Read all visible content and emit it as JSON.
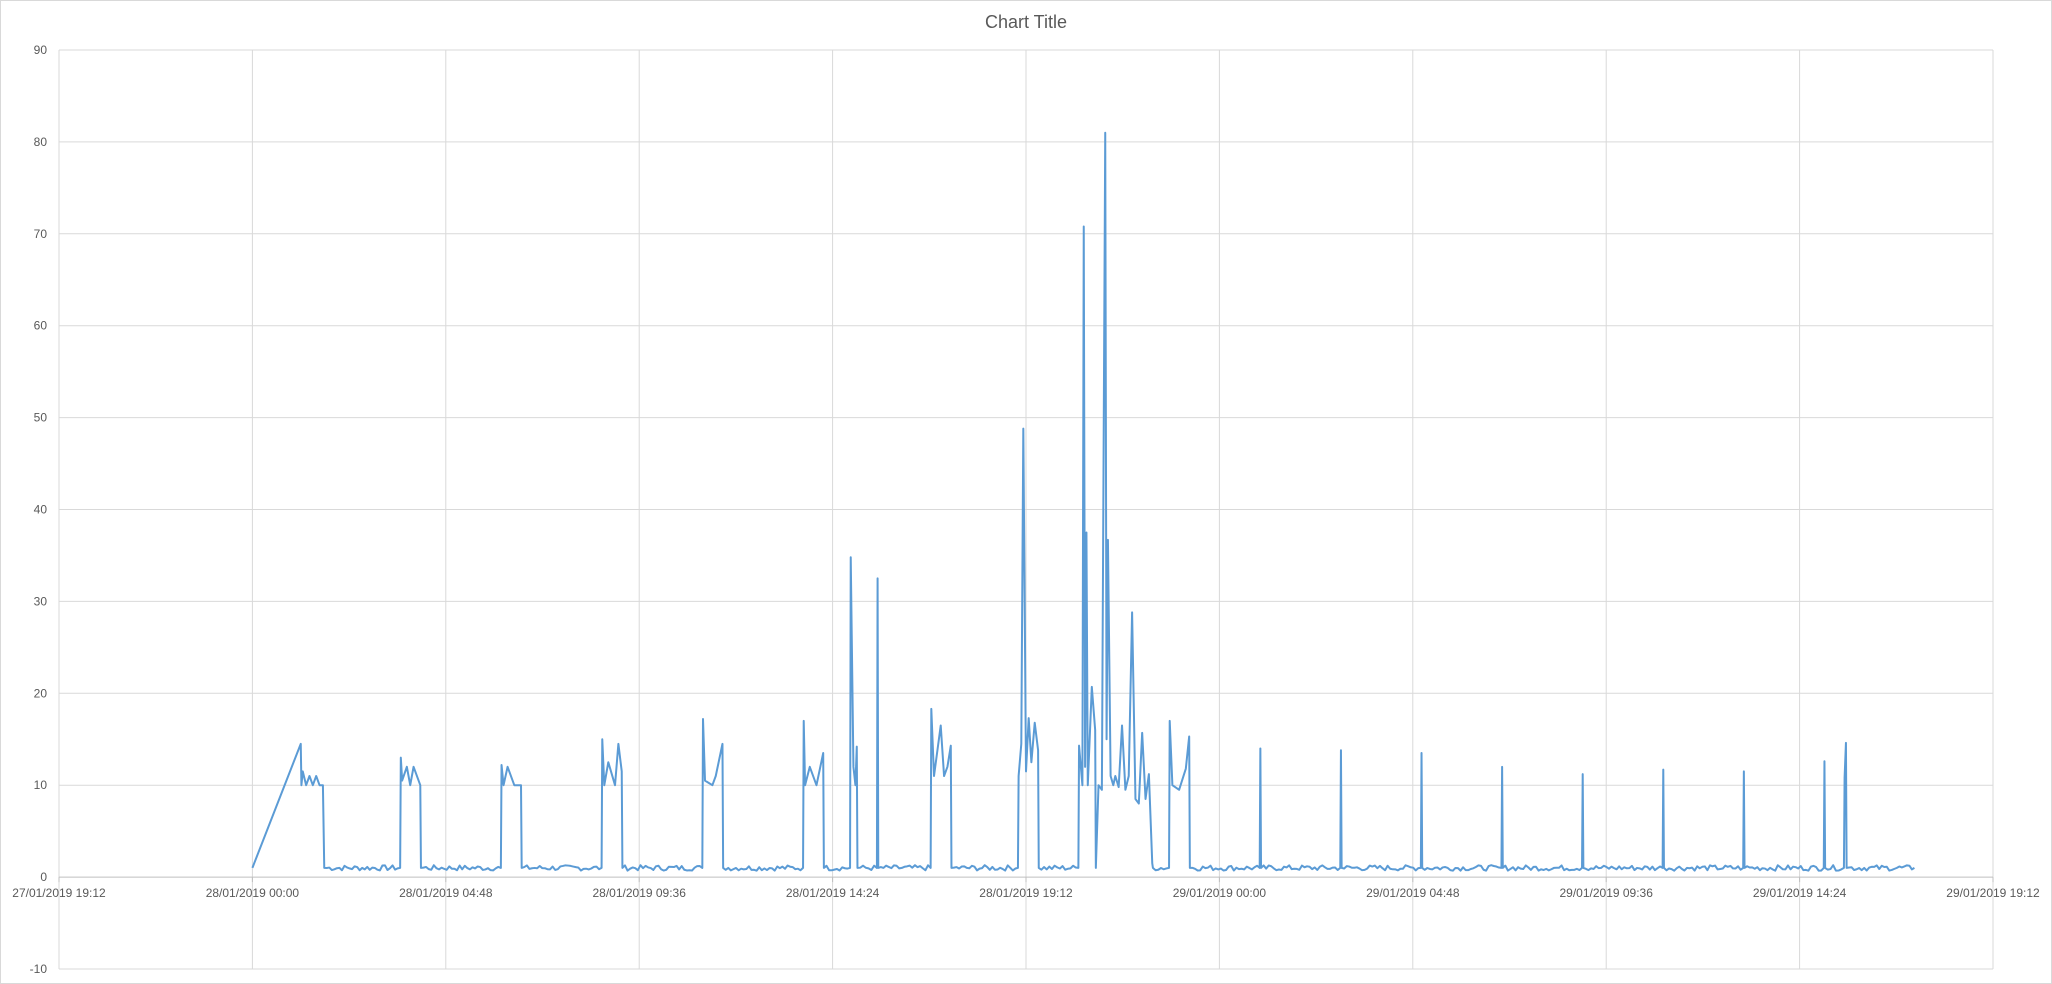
{
  "chart_data": {
    "type": "line",
    "title": "Chart Title",
    "xlabel": "",
    "ylabel": "",
    "x_tick_labels": [
      "27/01/2019 19:12",
      "28/01/2019 00:00",
      "28/01/2019 04:48",
      "28/01/2019 09:36",
      "28/01/2019 14:24",
      "28/01/2019 19:12",
      "29/01/2019 00:00",
      "29/01/2019 04:48",
      "29/01/2019 09:36",
      "29/01/2019 14:24",
      "29/01/2019 19:12"
    ],
    "y_tick_labels": [
      "-10",
      "0",
      "10",
      "20",
      "30",
      "40",
      "50",
      "60",
      "70",
      "80",
      "90"
    ],
    "xlim": [
      "27/01/2019 19:12",
      "29/01/2019 19:12"
    ],
    "ylim": [
      -10,
      90
    ],
    "grid": true,
    "legend": "none",
    "line_color": "#5b9bd5",
    "series": [
      {
        "baseline": 1.0,
        "x": [
          "28/01/2019 00:00",
          "28/01/2019 01:12",
          "28/01/2019 01:13",
          "28/01/2019 01:15",
          "28/01/2019 01:20",
          "28/01/2019 01:25",
          "28/01/2019 01:30",
          "28/01/2019 01:35",
          "28/01/2019 01:40",
          "28/01/2019 01:45",
          "28/01/2019 01:47",
          "28/01/2019 03:40",
          "28/01/2019 03:41",
          "28/01/2019 03:43",
          "28/01/2019 03:50",
          "28/01/2019 03:55",
          "28/01/2019 04:00",
          "28/01/2019 04:10",
          "28/01/2019 04:11",
          "28/01/2019 06:10",
          "28/01/2019 06:11",
          "28/01/2019 06:14",
          "28/01/2019 06:20",
          "28/01/2019 06:30",
          "28/01/2019 06:40",
          "28/01/2019 06:41",
          "28/01/2019 08:40",
          "28/01/2019 08:41",
          "28/01/2019 08:44",
          "28/01/2019 08:50",
          "28/01/2019 09:00",
          "28/01/2019 09:05",
          "28/01/2019 09:10",
          "28/01/2019 09:11",
          "28/01/2019 11:10",
          "28/01/2019 11:11",
          "28/01/2019 11:14",
          "28/01/2019 11:25",
          "28/01/2019 11:30",
          "28/01/2019 11:40",
          "28/01/2019 11:41",
          "28/01/2019 13:40",
          "28/01/2019 13:41",
          "28/01/2019 13:43",
          "28/01/2019 13:50",
          "28/01/2019 14:00",
          "28/01/2019 14:10",
          "28/01/2019 14:11",
          "28/01/2019 14:50",
          "28/01/2019 14:51",
          "28/01/2019 14:55",
          "28/01/2019 14:58",
          "28/01/2019 15:00",
          "28/01/2019 15:01",
          "28/01/2019 15:30",
          "28/01/2019 15:31",
          "28/01/2019 15:32",
          "28/01/2019 16:50",
          "28/01/2019 16:51",
          "28/01/2019 16:55",
          "28/01/2019 17:05",
          "28/01/2019 17:10",
          "28/01/2019 17:15",
          "28/01/2019 17:20",
          "28/01/2019 17:21",
          "28/01/2019 19:00",
          "28/01/2019 19:01",
          "28/01/2019 19:05",
          "28/01/2019 19:08",
          "28/01/2019 19:12",
          "28/01/2019 19:16",
          "28/01/2019 19:20",
          "28/01/2019 19:25",
          "28/01/2019 19:30",
          "28/01/2019 19:31",
          "28/01/2019 20:30",
          "28/01/2019 20:31",
          "28/01/2019 20:36",
          "28/01/2019 20:38",
          "28/01/2019 20:40",
          "28/01/2019 20:42",
          "28/01/2019 20:44",
          "28/01/2019 20:50",
          "28/01/2019 20:55",
          "28/01/2019 20:56",
          "28/01/2019 21:00",
          "28/01/2019 21:05",
          "28/01/2019 21:10",
          "28/01/2019 21:12",
          "28/01/2019 21:14",
          "28/01/2019 21:18",
          "28/01/2019 21:22",
          "28/01/2019 21:25",
          "28/01/2019 21:30",
          "28/01/2019 21:35",
          "28/01/2019 21:40",
          "28/01/2019 21:45",
          "28/01/2019 21:50",
          "28/01/2019 21:55",
          "28/01/2019 22:00",
          "28/01/2019 22:05",
          "28/01/2019 22:10",
          "28/01/2019 22:15",
          "28/01/2019 22:20",
          "28/01/2019 22:21",
          "28/01/2019 22:45",
          "28/01/2019 22:46",
          "28/01/2019 22:50",
          "28/01/2019 23:00",
          "28/01/2019 23:10",
          "28/01/2019 23:15",
          "28/01/2019 23:16",
          "29/01/2019 01:00",
          "29/01/2019 01:01",
          "29/01/2019 01:02",
          "29/01/2019 03:00",
          "29/01/2019 03:01",
          "29/01/2019 03:02",
          "29/01/2019 05:00",
          "29/01/2019 05:01",
          "29/01/2019 05:02",
          "29/01/2019 07:00",
          "29/01/2019 07:01",
          "29/01/2019 07:02",
          "29/01/2019 09:00",
          "29/01/2019 09:01",
          "29/01/2019 09:02",
          "29/01/2019 11:00",
          "29/01/2019 11:01",
          "29/01/2019 11:02",
          "29/01/2019 13:00",
          "29/01/2019 13:01",
          "29/01/2019 13:02",
          "29/01/2019 15:00",
          "29/01/2019 15:01",
          "29/01/2019 15:02",
          "29/01/2019 15:30",
          "29/01/2019 15:31",
          "29/01/2019 15:33",
          "29/01/2019 15:34",
          "29/01/2019 17:15"
        ],
        "y": [
          1,
          14.5,
          10,
          11.5,
          10,
          11,
          10,
          11,
          10,
          10,
          1,
          1,
          13,
          10.5,
          12,
          10,
          12,
          10,
          1,
          1,
          12.2,
          10,
          12,
          10,
          10,
          1,
          1,
          15,
          10,
          12.5,
          10,
          14.5,
          11.5,
          1,
          1,
          17.2,
          10.5,
          10,
          11,
          14.5,
          1,
          1,
          17,
          10,
          12,
          10,
          13.5,
          1,
          1,
          34.8,
          12,
          10,
          14.2,
          1,
          1,
          32.5,
          1,
          1,
          18.3,
          11,
          16.5,
          11,
          12,
          14.3,
          1,
          1,
          11,
          14.5,
          48.8,
          11.5,
          17.3,
          12.5,
          16.8,
          13.8,
          1,
          1,
          14.3,
          10,
          70.8,
          12,
          37.5,
          10,
          20.7,
          16,
          1,
          10,
          9.5,
          81,
          15,
          36.7,
          11,
          10,
          11,
          9.8,
          16.5,
          9.5,
          11,
          28.8,
          8.5,
          8,
          15.7,
          8.5,
          11.2,
          1.5,
          1,
          1,
          17,
          10,
          9.5,
          11.8,
          15.3,
          1,
          1,
          14,
          1,
          1,
          13.8,
          1,
          1,
          13.5,
          1,
          1,
          12,
          1,
          1,
          11.2,
          1,
          1,
          11.7,
          1,
          1,
          11.5,
          1,
          1,
          12.6,
          1,
          1,
          10.8,
          14.6,
          1,
          1
        ]
      }
    ]
  }
}
